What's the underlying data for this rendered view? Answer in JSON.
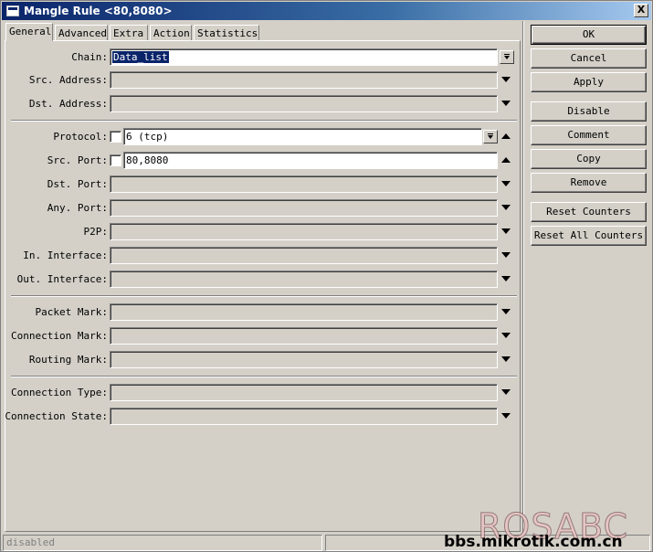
{
  "window": {
    "title": "Mangle Rule <80,8080>",
    "close_label": "X"
  },
  "tabs": [
    "General",
    "Advanced",
    "Extra",
    "Action",
    "Statistics"
  ],
  "active_tab": "General",
  "fields": {
    "chain": {
      "label": "Chain:",
      "value": "Data_list"
    },
    "src_address": {
      "label": "Src. Address:",
      "value": ""
    },
    "dst_address": {
      "label": "Dst. Address:",
      "value": ""
    },
    "protocol": {
      "label": "Protocol:",
      "value": "6 (tcp)"
    },
    "src_port": {
      "label": "Src. Port:",
      "value": "80,8080"
    },
    "dst_port": {
      "label": "Dst. Port:",
      "value": ""
    },
    "any_port": {
      "label": "Any. Port:",
      "value": ""
    },
    "p2p": {
      "label": "P2P:",
      "value": ""
    },
    "in_interface": {
      "label": "In. Interface:",
      "value": ""
    },
    "out_interface": {
      "label": "Out. Interface:",
      "value": ""
    },
    "packet_mark": {
      "label": "Packet Mark:",
      "value": ""
    },
    "connection_mark": {
      "label": "Connection Mark:",
      "value": ""
    },
    "routing_mark": {
      "label": "Routing Mark:",
      "value": ""
    },
    "connection_type": {
      "label": "Connection Type:",
      "value": ""
    },
    "connection_state": {
      "label": "Connection State:",
      "value": ""
    }
  },
  "buttons": {
    "ok": "OK",
    "cancel": "Cancel",
    "apply": "Apply",
    "disable": "Disable",
    "comment": "Comment",
    "copy": "Copy",
    "remove": "Remove",
    "reset_counters": "Reset Counters",
    "reset_all_counters": "Reset All Counters"
  },
  "status": {
    "left": "disabled",
    "right": ""
  },
  "watermark": {
    "logo": "ROSABC",
    "url": "bbs.mikrotik.com.cn"
  },
  "icons": {
    "window": "window-icon",
    "close": "close-icon",
    "dropdown": "dropdown-icon",
    "expand_down": "triangle-down-icon",
    "collapse_up": "triangle-up-icon"
  }
}
